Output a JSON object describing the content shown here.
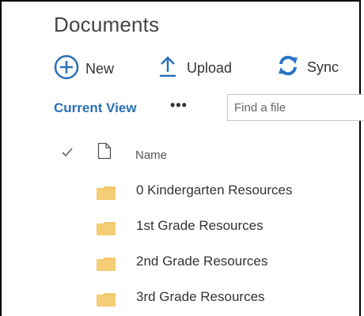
{
  "page": {
    "title": "Documents"
  },
  "toolbar": {
    "new_label": "New",
    "upload_label": "Upload",
    "sync_label": "Sync"
  },
  "view": {
    "current_view_label": "Current View",
    "more_label": "•••"
  },
  "search": {
    "placeholder": "Find a file",
    "value": ""
  },
  "list": {
    "columns": {
      "name": "Name"
    },
    "items": [
      {
        "name": "0 Kindergarten Resources",
        "type": "folder"
      },
      {
        "name": "1st Grade Resources",
        "type": "folder"
      },
      {
        "name": "2nd Grade Resources",
        "type": "folder"
      },
      {
        "name": "3rd Grade Resources",
        "type": "folder"
      }
    ]
  },
  "icons": {
    "new": "plus-circle-icon",
    "upload": "upload-arrow-icon",
    "sync": "sync-icon",
    "select_all": "checkmark-icon",
    "file_type": "document-icon",
    "folder": "folder-icon"
  },
  "colors": {
    "accent_blue": "#2b6fb8",
    "sync_blue": "#2a74c7",
    "folder_yellow": "#f2c768",
    "text": "#333333",
    "title_text": "#444444"
  }
}
